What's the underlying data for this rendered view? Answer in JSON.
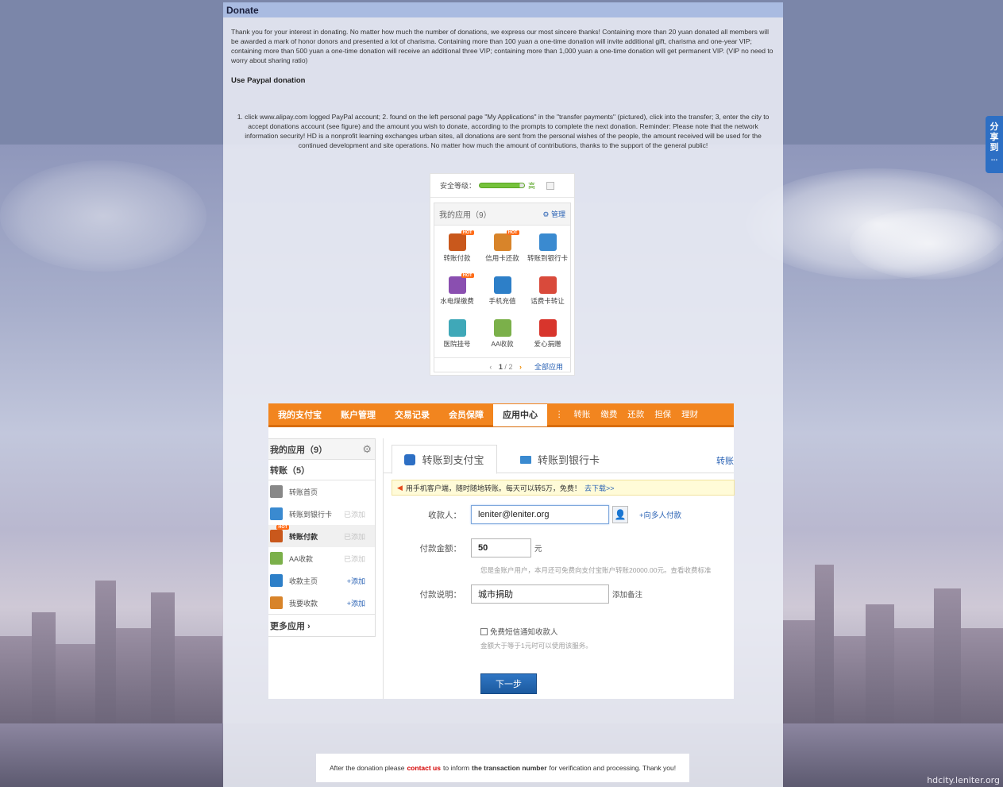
{
  "share_tab": {
    "label": "分享到",
    "dots": "…"
  },
  "watermark": "hdcity.leniter.org",
  "panel": {
    "title": "Donate",
    "intro": "Thank you for your interest in donating. No matter how much the number of donations, we express our most sincere thanks! Containing more than 20 yuan donated all members will be awarded a mark of honor donors and presented a lot of charisma. Containing more than 100 yuan a one-time donation will invite additional gift, charisma and one-year VIP; containing more than 500 yuan a one-time donation will receive an additional three VIP; containing more than 1,000 yuan a one-time donation will get permanent VIP. (VIP no need to worry about sharing ratio)",
    "paypal_title": "Use Paypal donation",
    "steps": "1. click www.alipay.com logged PayPal account; 2. found on the left personal page \"My Applications\" in the \"transfer payments\" (pictured), click into the transfer; 3, enter the city to accept donations account (see figure) and the amount you wish to donate, according to the prompts to complete the next donation. Reminder: Please note that the network information security! HD is a nonprofit learning exchanges urban sites, all donations are sent from the personal wishes of the people, the amount received will be used for the continued development and site operations. No matter how much the amount of contributions, thanks to the support of the general public!"
  },
  "apps_shot": {
    "security_label": "安全等级：",
    "security_level": "高",
    "security_fill": 0.9,
    "header": "我的应用（9）",
    "manage": "管理",
    "apps": [
      {
        "label": "转账付款",
        "hot": "HOT",
        "color": "#c9581c"
      },
      {
        "label": "信用卡还款",
        "hot": "HOT",
        "color": "#d8842a"
      },
      {
        "label": "转账到银行卡",
        "hot": "",
        "color": "#3a8ad0"
      },
      {
        "label": "水电煤缴费",
        "hot": "HOT",
        "color": "#8a4fb0"
      },
      {
        "label": "手机充值",
        "hot": "",
        "color": "#2d7fc8"
      },
      {
        "label": "话费卡转让",
        "hot": "",
        "color": "#d94a3b"
      },
      {
        "label": "医院挂号",
        "hot": "",
        "color": "#3fa8b8"
      },
      {
        "label": "AA收款",
        "hot": "",
        "color": "#7bb04a"
      },
      {
        "label": "爱心捐赠",
        "hot": "",
        "color": "#d8352c"
      }
    ],
    "pager": {
      "current": "1",
      "sep": "/",
      "total": "2"
    },
    "all_apps": "全部应用"
  },
  "xfer": {
    "nav": [
      "我的支付宝",
      "账户管理",
      "交易记录",
      "会员保障"
    ],
    "nav_active": "应用中心",
    "nav_sep": "⋮",
    "nav_sub": [
      "转账",
      "缴费",
      "还款",
      "担保",
      "理财"
    ],
    "side": {
      "header": "我的应用（9）",
      "sub": "转账（5）",
      "items": [
        {
          "label": "转账首页",
          "status": "",
          "color": "#888"
        },
        {
          "label": "转账到银行卡",
          "status": "已添加",
          "color": "#3a8ad0"
        },
        {
          "label": "转账付款",
          "status": "已添加",
          "color": "#c9581c"
        },
        {
          "label": "AA收款",
          "status": "已添加",
          "color": "#7bb04a"
        },
        {
          "label": "收款主页",
          "status": "+添加",
          "color": "#2d7fc8"
        },
        {
          "label": "我要收款",
          "status": "+添加",
          "color": "#d8842a"
        }
      ],
      "hot": "HOT",
      "more": "更多应用 ›"
    },
    "tabs": {
      "active": "转账到支付宝",
      "second": "转账到银行卡",
      "more": "转账"
    },
    "notice": {
      "text": "用手机客户端，随时随地转账。每天可以转5万，免费！",
      "link": "去下载>>"
    },
    "form": {
      "payee_label": "收款人：",
      "payee_value": "leniter@leniter.org",
      "multi": "+向多人付款",
      "amount_label": "付款金额：",
      "amount_value": "50",
      "amount_unit": "元",
      "amount_tip": "您是金账户用户，本月还可免费向支付宝账户转账20000.00元。查看收费标准",
      "memo_label": "付款说明：",
      "memo_value": "城市捐助",
      "memo_add": "添加备注",
      "sms_label": "免费短信通知收款人",
      "sms_tip": "金额大于等于1元时可以使用该服务。",
      "submit": "下一步"
    }
  },
  "footer": {
    "pre": "After the donation please",
    "contact": "contact us",
    "mid": "to inform",
    "strong": "the transaction number",
    "post": "for verification and processing. Thank you!"
  }
}
